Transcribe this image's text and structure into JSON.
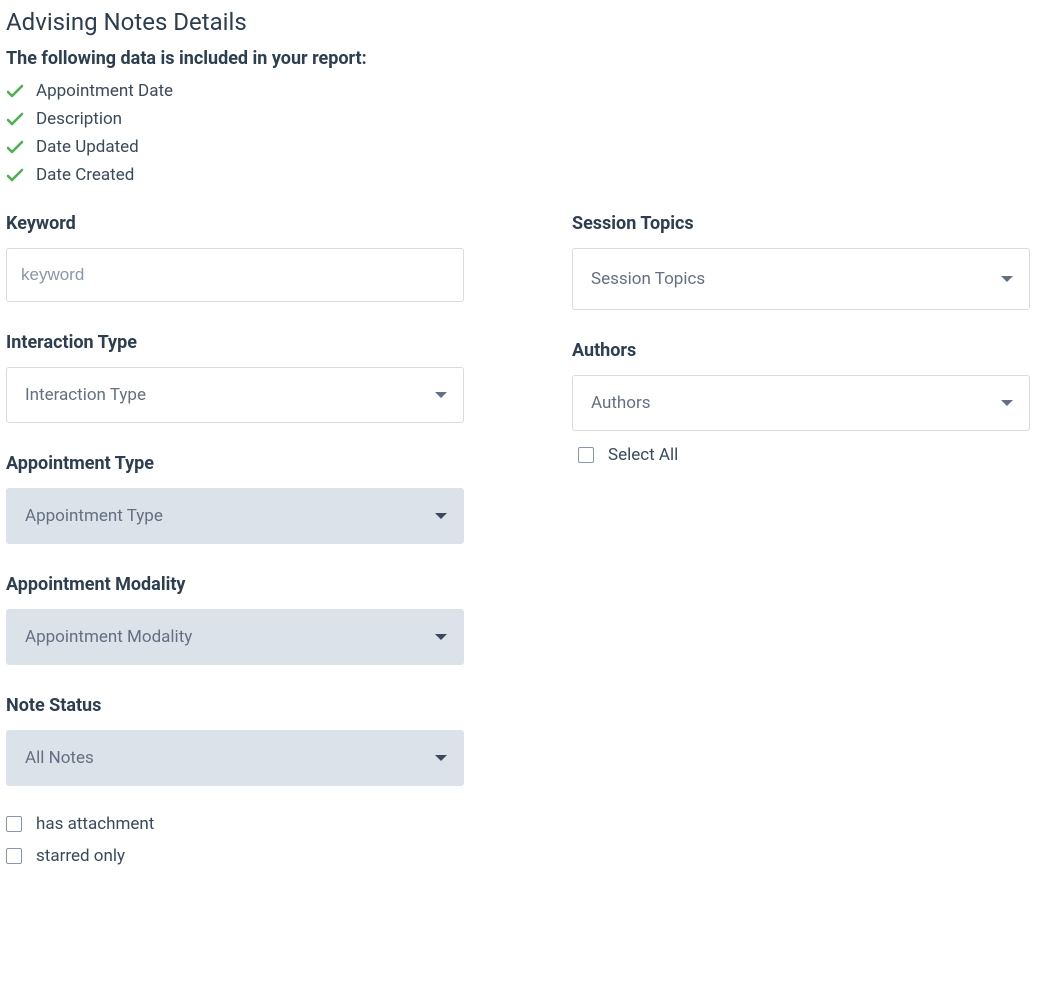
{
  "page": {
    "title": "Advising Notes Details",
    "subtitle": "The following data is included in your report:"
  },
  "included": [
    "Appointment Date",
    "Description",
    "Date Updated",
    "Date Created"
  ],
  "left": {
    "keyword": {
      "label": "Keyword",
      "placeholder": "keyword",
      "value": ""
    },
    "interaction_type": {
      "label": "Interaction Type",
      "placeholder": "Interaction Type"
    },
    "appointment_type": {
      "label": "Appointment Type",
      "placeholder": "Appointment Type"
    },
    "appointment_modality": {
      "label": "Appointment Modality",
      "placeholder": "Appointment Modality"
    },
    "note_status": {
      "label": "Note Status",
      "value": "All Notes"
    },
    "has_attachment": {
      "label": "has attachment",
      "checked": false
    },
    "starred_only": {
      "label": "starred only",
      "checked": false
    }
  },
  "right": {
    "session_topics": {
      "label": "Session Topics",
      "placeholder": "Session Topics"
    },
    "authors": {
      "label": "Authors",
      "placeholder": "Authors",
      "select_all_label": "Select All",
      "select_all_checked": false
    }
  }
}
